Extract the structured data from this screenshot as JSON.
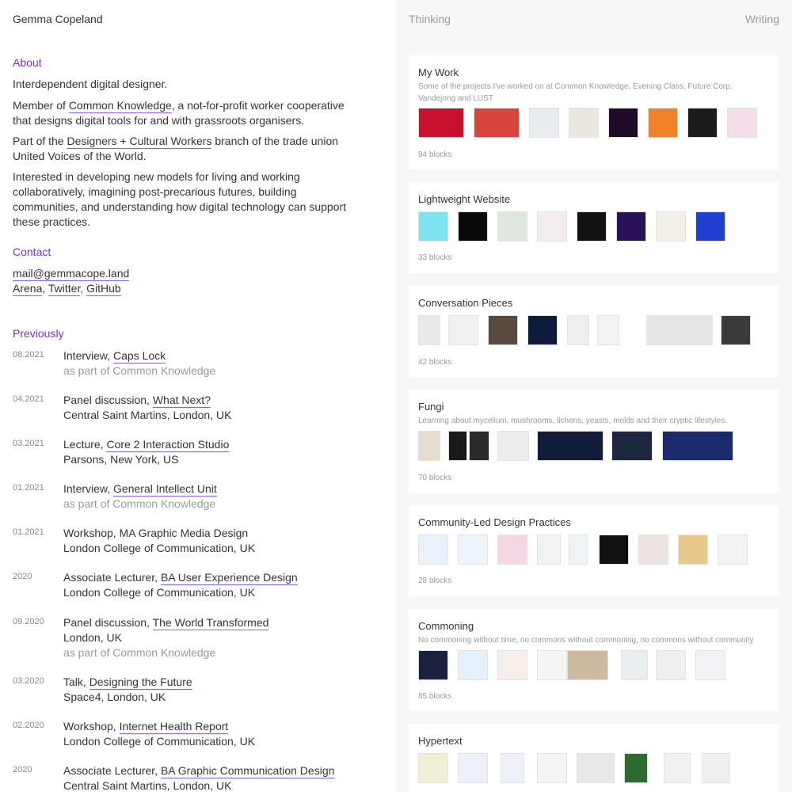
{
  "site_name": "Gemma Copeland",
  "nav": {
    "thinking": "Thinking",
    "writing": "Writing"
  },
  "about": {
    "heading": "About",
    "intro": "Interdependent digital designer.",
    "member_pre": "Member of",
    "member_link": "Common Knowledge",
    "member_post": ", a not-for-profit worker cooperative that designs digital tools for and with grassroots organisers.",
    "part_pre": "Part of the",
    "part_link": "Designers + Cultural Workers",
    "part_post": "branch of the trade union United Voices of the World.",
    "interests": "Interested in developing new models for living and working collaboratively, imagining post-precarious futures, building communities, and understanding how digital technology can support these practices."
  },
  "contact": {
    "heading": "Contact",
    "email": "mail@gemmacope.land",
    "link_arena": "Arena",
    "link_twitter": "Twitter",
    "link_github": "GitHub",
    "sep": ","
  },
  "previously": {
    "heading": "Previously",
    "items": [
      {
        "date": "08.2021",
        "pre": "Interview,",
        "link": "Caps Lock",
        "line2": "as part of Common Knowledge",
        "line2_muted": true
      },
      {
        "date": "04.2021",
        "pre": "Panel discussion,",
        "link": "What Next?",
        "line2": "Central Saint Martins, London, UK",
        "line2_muted": false
      },
      {
        "date": "03.2021",
        "pre": "Lecture,",
        "link": "Core 2 Interaction Studio",
        "line2": "Parsons, New York, US",
        "line2_muted": false
      },
      {
        "date": "01.2021",
        "pre": "Interview,",
        "link": "General Intellect Unit",
        "line2": "as part of Common Knowledge",
        "line2_muted": true
      },
      {
        "date": "01.2021",
        "pre": "Workshop, MA Graphic Media Design",
        "link": "",
        "line2": "London College of Communication, UK",
        "line2_muted": false
      },
      {
        "date": "2020",
        "pre": "Associate Lecturer,",
        "link": "BA User Experience Design",
        "line2": "London College of Communication, UK",
        "line2_muted": false
      },
      {
        "date": "09.2020",
        "pre": "Panel discussion,",
        "link": "The World Transformed",
        "line2": "London, UK",
        "line2_muted": false,
        "line3": "as part of Common Knowledge"
      },
      {
        "date": "03.2020",
        "pre": "Talk,",
        "link": "Designing the Future",
        "line2": "Space4, London, UK",
        "line2_muted": false
      },
      {
        "date": "02.2020",
        "pre": "Workshop,",
        "link": "Internet Health Report",
        "line2": "London College of Communication, UK",
        "line2_muted": false
      },
      {
        "date": "2020",
        "pre": "Associate Lecturer,",
        "link": "BA Graphic Communication Design",
        "line2": "Central Saint Martins, London, UK",
        "line2_muted": false
      }
    ]
  },
  "channels": [
    {
      "title": "My Work",
      "desc": "Some of the projects I've worked on at Common Knowledge, Evening Class, Future Corp, Vandejong and LUST",
      "count": "94 blocks",
      "thumbs": [
        "#c8102e",
        "#d8453a",
        "#e8ecef",
        "#ebe7e0",
        "#1d0b28",
        "#f0822a",
        "#1b1b1b",
        "#f4dfe9"
      ]
    },
    {
      "title": "Lightweight Website",
      "desc": "",
      "count": "33 blocks",
      "thumbs": [
        "#7fe3f0",
        "#0a0a0a",
        "#dfe6dd",
        "#f3ecec",
        "#111111",
        "#2a1056",
        "#f1efe6",
        "#1f3fd1"
      ]
    },
    {
      "title": "Conversation Pieces",
      "desc": "",
      "count": "42 blocks",
      "thumbs": [
        "#e9e9e9",
        "#f0f0f0",
        "#5a4a3e",
        "#0f1b3d",
        "#ededed",
        "#f3f3f3",
        "#e6e6e6",
        "#3a3a3a"
      ]
    },
    {
      "title": "Fungi",
      "desc": "Learning about mycelium, mushrooms, lichens, yeasts, molds and their cryptic lifestyles.",
      "count": "70 blocks",
      "thumbs": [
        "#e6dccb",
        "#1a1a1a",
        "#2b2b2b",
        "#ececec",
        "#101c3a",
        "#1e2740",
        "#1c2a6e"
      ]
    },
    {
      "title": "Community-Led Design Practices",
      "desc": "",
      "count": "28 blocks",
      "thumbs": [
        "#e9f1fb",
        "#eef4fb",
        "#f4d7e3",
        "#f2f2f2",
        "#eef3f5",
        "#111111",
        "#ebe3df",
        "#e8c98b",
        "#f3f3f3"
      ]
    },
    {
      "title": "Commoning",
      "desc": "No commoning without time, no commons without commoning, no commons without community",
      "count": "85 blocks",
      "thumbs": [
        "#1a2040",
        "#e4f0fa",
        "#f6efe9",
        "#f5f5f5",
        "#cdb9a0",
        "#e9eff0",
        "#efefef",
        "#f2f2f6"
      ]
    },
    {
      "title": "Hypertext",
      "desc": "",
      "count": "",
      "thumbs": [
        "#f0efd5",
        "#eef2f8",
        "#edf1f7",
        "#f4f4f4",
        "#e8e8e8",
        "#2e6b2e",
        "#f1f1f1",
        "#efefef"
      ]
    }
  ]
}
